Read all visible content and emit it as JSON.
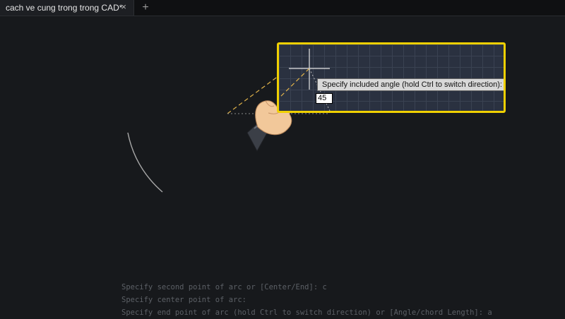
{
  "tabs": [
    {
      "label": "cach ve cung trong trong CAD*",
      "close_icon": "close-icon"
    }
  ],
  "add_tab_label": "+",
  "zoom_callout": {
    "highlight_color": "#f0d000",
    "tooltip": "Specify included angle (hold Ctrl to switch direction):",
    "input_value": "45"
  },
  "command_history": [
    "Specify second point of arc or [Center/End]: c",
    "Specify center point of arc:",
    "Specify end point of arc (hold Ctrl to switch direction) or [Angle/chord Length]: a"
  ],
  "icons": [
    "crosshair-cursor-icon",
    "pointing-hand-icon",
    "close-icon",
    "plus-icon"
  ]
}
